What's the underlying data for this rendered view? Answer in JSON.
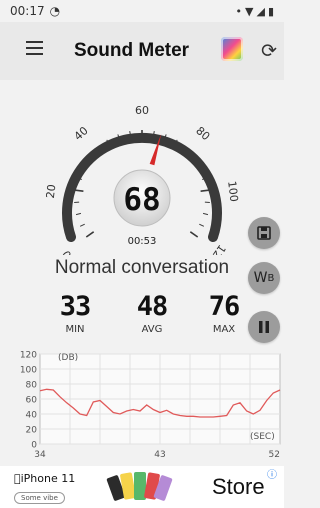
{
  "status_bar": {
    "time": "00:17",
    "activity_icon": "meter-icon",
    "signal_icons": [
      "wifi-icon",
      "cellular-icon",
      "battery-icon"
    ]
  },
  "app_bar": {
    "title": "Sound Meter",
    "menu_icon": "hamburger-menu-icon",
    "theme_icon": "theme-palette-icon",
    "refresh_icon": "refresh-icon"
  },
  "gauge": {
    "value": "68",
    "elapsed": "00:53",
    "needle_value": 68,
    "scale_labels": [
      "0",
      "20",
      "40",
      "60",
      "80",
      "100",
      "120"
    ]
  },
  "status_text": "Normal conversation",
  "stats": {
    "min": {
      "value": "33",
      "label": "MIN"
    },
    "avg": {
      "value": "48",
      "label": "AVG"
    },
    "max": {
      "value": "76",
      "label": "MAX"
    }
  },
  "side_buttons": {
    "save_icon": "save-icon",
    "weighting_label": "W",
    "weighting_sub": "B",
    "pause_icon": "pause-icon"
  },
  "chart_data": {
    "type": "line",
    "ylabel": "(DB)",
    "xlabel": "(SEC)",
    "ylim": [
      0,
      120
    ],
    "xlim": [
      34,
      52
    ],
    "y_ticks": [
      "120",
      "100",
      "80",
      "60",
      "40",
      "20",
      "0"
    ],
    "x_ticks": [
      "34",
      "43",
      "52"
    ],
    "grid": true,
    "x": [
      34,
      34.5,
      35,
      35.5,
      36,
      36.5,
      37,
      37.5,
      38,
      38.5,
      39,
      39.5,
      40,
      40.5,
      41,
      41.5,
      42,
      42.5,
      43,
      43.5,
      44,
      44.5,
      45,
      45.5,
      46,
      46.5,
      47,
      47.5,
      48,
      48.5,
      49,
      49.5,
      50,
      50.5,
      51,
      51.5,
      52
    ],
    "values": [
      71,
      73,
      72,
      63,
      55,
      48,
      40,
      38,
      56,
      58,
      50,
      42,
      40,
      44,
      46,
      44,
      52,
      46,
      42,
      45,
      40,
      38,
      37,
      37,
      36,
      36,
      36,
      37,
      38,
      52,
      55,
      44,
      40,
      45,
      58,
      68,
      72
    ]
  },
  "ad": {
    "brand": "iPhone 11",
    "pill": "Some vibe",
    "store": "Store"
  }
}
